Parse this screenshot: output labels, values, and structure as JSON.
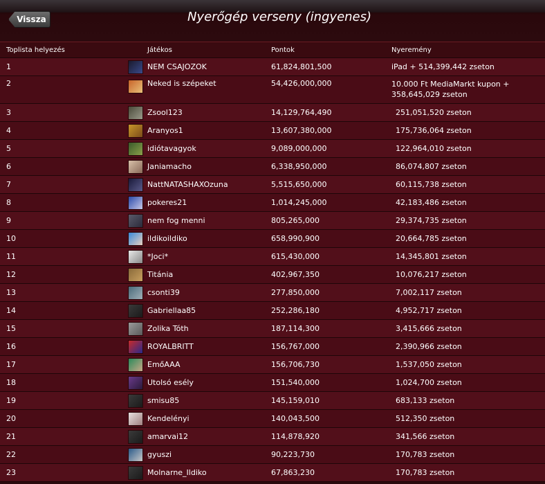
{
  "header": {
    "back_label": "Vissza",
    "title": "Nyerőgép verseny (ingyenes)"
  },
  "columns": {
    "rank": "Toplista helyezés",
    "player": "Játékos",
    "points": "Pontok",
    "prize": "Nyeremény"
  },
  "rows": [
    {
      "rank": "1",
      "player": "NEM CSAJOZOK",
      "points": "61,824,801,500",
      "prize": "iPad  + 514,399,442 zseton",
      "avatar_colors": [
        "#1a1a2e",
        "#3a4a8a"
      ]
    },
    {
      "rank": "2",
      "player": "Neked is szépeket",
      "points": "54,426,000,000",
      "prize": "10.000 Ft MediaMarkt kupon  + 358,645,029 zseton",
      "avatar_colors": [
        "#c8642a",
        "#e8c07a"
      ]
    },
    {
      "rank": "3",
      "player": "Zsool123",
      "points": "14,129,764,490",
      "prize": "251,051,520 zseton",
      "avatar_colors": [
        "#4a4a3a",
        "#9a9a8a"
      ]
    },
    {
      "rank": "4",
      "player": "Aranyos1",
      "points": "13,607,380,000",
      "prize": "175,736,064 zseton",
      "avatar_colors": [
        "#c8962a",
        "#7a4a1a"
      ]
    },
    {
      "rank": "5",
      "player": "idiótavagyok",
      "points": "9,089,000,000",
      "prize": "122,964,010 zseton",
      "avatar_colors": [
        "#3a5a2a",
        "#8aa04a"
      ]
    },
    {
      "rank": "6",
      "player": "Janiamacho",
      "points": "6,338,950,000",
      "prize": "86,074,807 zseton",
      "avatar_colors": [
        "#d8c0a8",
        "#8a6a5a"
      ]
    },
    {
      "rank": "7",
      "player": "NattNATASHAXOzuna",
      "points": "5,515,650,000",
      "prize": "60,115,738 zseton",
      "avatar_colors": [
        "#1a1a3a",
        "#5a5a8a"
      ]
    },
    {
      "rank": "8",
      "player": "pokeres21",
      "points": "1,014,245,000",
      "prize": "42,183,486 zseton",
      "avatar_colors": [
        "#2a4aaa",
        "#c8c8e8"
      ]
    },
    {
      "rank": "9",
      "player": "nem fog menni",
      "points": "805,265,000",
      "prize": "29,374,735 zseton",
      "avatar_colors": [
        "#5a5a6a",
        "#2a2a3a"
      ]
    },
    {
      "rank": "10",
      "player": "ildikoildiko",
      "points": "658,990,900",
      "prize": "20,664,785 zseton",
      "avatar_colors": [
        "#3a8ad8",
        "#e8d0c0"
      ]
    },
    {
      "rank": "11",
      "player": "*Joci*",
      "points": "615,430,000",
      "prize": "14,345,801 zseton",
      "avatar_colors": [
        "#e8e8e8",
        "#8a8a8a"
      ]
    },
    {
      "rank": "12",
      "player": "Titánia",
      "points": "402,967,350",
      "prize": "10,076,217 zseton",
      "avatar_colors": [
        "#8a6a3a",
        "#c8a060"
      ]
    },
    {
      "rank": "13",
      "player": "csonti39",
      "points": "277,850,000",
      "prize": "7,002,117 zseton",
      "avatar_colors": [
        "#4a6a7a",
        "#a0b0b8"
      ]
    },
    {
      "rank": "14",
      "player": "Gabriellaa85",
      "points": "252,286,180",
      "prize": "4,952,717 zseton",
      "avatar_colors": [
        "#3a3a3a",
        "#1a1a1a"
      ]
    },
    {
      "rank": "15",
      "player": "Zolika Tóth",
      "points": "187,114,300",
      "prize": "3,415,666 zseton",
      "avatar_colors": [
        "#9a9a9a",
        "#5a5a5a"
      ]
    },
    {
      "rank": "16",
      "player": "ROYALBRITT",
      "points": "156,767,000",
      "prize": "2,390,966 zseton",
      "avatar_colors": [
        "#c82a2a",
        "#2a2a8a"
      ]
    },
    {
      "rank": "17",
      "player": "EmőAAA",
      "points": "156,706,730",
      "prize": "1,537,050 zseton",
      "avatar_colors": [
        "#2a8a5a",
        "#c8a888"
      ]
    },
    {
      "rank": "18",
      "player": "Utolsó esély",
      "points": "151,540,000",
      "prize": "1,024,700 zseton",
      "avatar_colors": [
        "#6a3a8a",
        "#2a1a3a"
      ]
    },
    {
      "rank": "19",
      "player": "smisu85",
      "points": "145,159,010",
      "prize": "683,133 zseton",
      "avatar_colors": [
        "#3a3a3a",
        "#1a1a1a"
      ]
    },
    {
      "rank": "20",
      "player": "Kendelényi",
      "points": "140,043,500",
      "prize": "512,350 zseton",
      "avatar_colors": [
        "#e8e0e0",
        "#a08080"
      ]
    },
    {
      "rank": "21",
      "player": "amarvai12",
      "points": "114,878,920",
      "prize": "341,566 zseton",
      "avatar_colors": [
        "#3a3a3a",
        "#1a1a1a"
      ]
    },
    {
      "rank": "22",
      "player": "gyuszi",
      "points": "90,223,730",
      "prize": "170,783 zseton",
      "avatar_colors": [
        "#2a5a8a",
        "#c8c8c8"
      ]
    },
    {
      "rank": "23",
      "player": "Molnarne_Ildiko",
      "points": "67,863,230",
      "prize": "170,783 zseton",
      "avatar_colors": [
        "#3a3a3a",
        "#1a1a1a"
      ]
    }
  ]
}
